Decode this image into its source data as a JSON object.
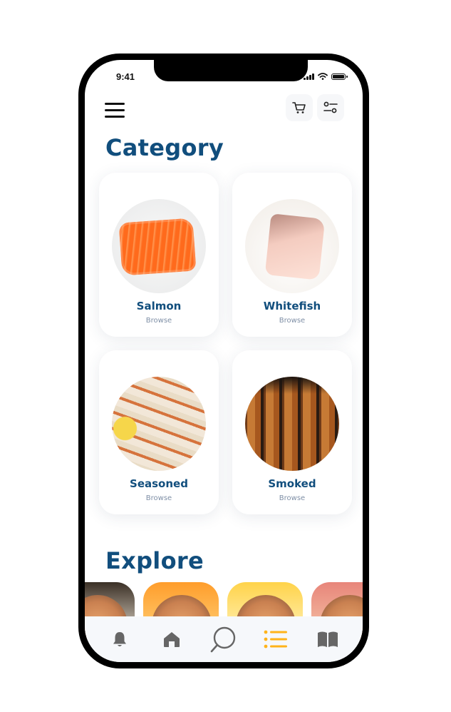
{
  "status_bar": {
    "time": "9:41"
  },
  "header": {
    "menu_icon": "hamburger-menu-icon",
    "cart_icon": "shopping-cart-icon",
    "filter_icon": "filter-sliders-icon"
  },
  "category": {
    "title": "Category",
    "items": [
      {
        "name": "Salmon",
        "action": "Browse"
      },
      {
        "name": "Whitefish",
        "action": "Browse"
      },
      {
        "name": "Seasoned",
        "action": "Browse"
      },
      {
        "name": "Smoked",
        "action": "Browse"
      }
    ]
  },
  "explore": {
    "title": "Explore"
  },
  "tabbar": {
    "items": [
      {
        "icon": "bell-icon",
        "active": false
      },
      {
        "icon": "home-icon",
        "active": false
      },
      {
        "icon": "search-icon",
        "active": false
      },
      {
        "icon": "list-icon",
        "active": true
      },
      {
        "icon": "book-icon",
        "active": false
      }
    ]
  },
  "colors": {
    "brand": "#114e7d",
    "muted": "#7f8fa6",
    "accent": "#ffb31a",
    "icon": "#666666"
  }
}
